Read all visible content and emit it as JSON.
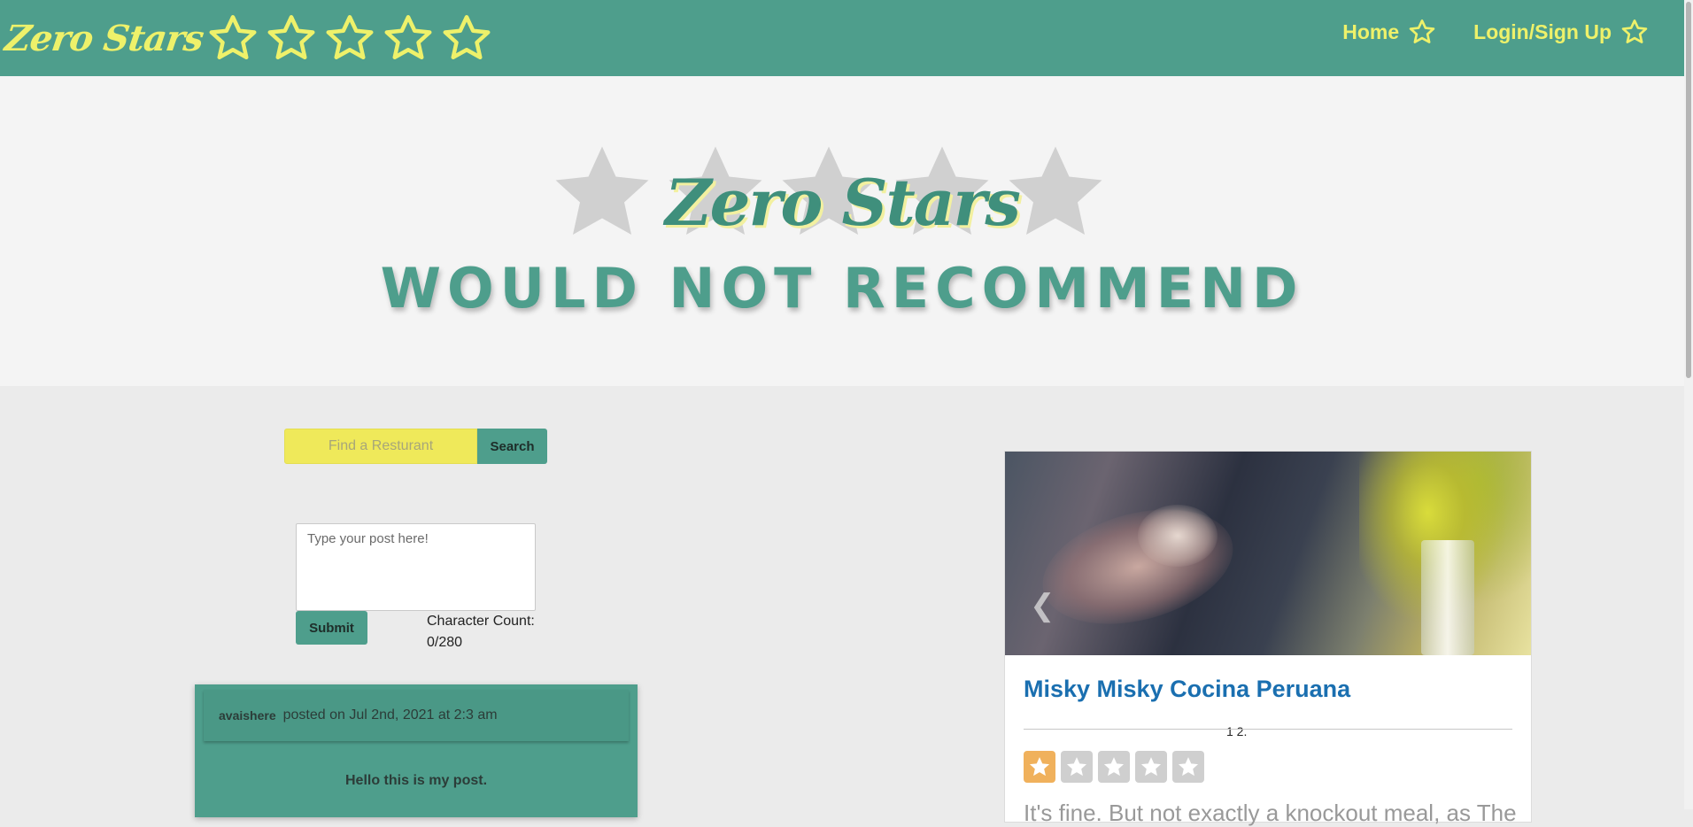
{
  "navbar": {
    "brand": "Zero Stars",
    "links": [
      {
        "label": "Home"
      },
      {
        "label": "Login/Sign Up"
      }
    ],
    "colors": {
      "background": "#4e9e8c",
      "accent": "#eef16a"
    }
  },
  "hero": {
    "title": "Zero Stars",
    "tagline": "WOULD NOT RECOMMEND"
  },
  "search": {
    "placeholder": "Find a Resturant",
    "button_label": "Search"
  },
  "post_form": {
    "placeholder": "Type your post here!",
    "submit_label": "Submit",
    "char_count_label": "Character Count:",
    "char_count_value": "0/280"
  },
  "posts": [
    {
      "author": "avaishere",
      "date": "posted on Jul 2nd, 2021 at 2:3 am",
      "body": "Hello this is my post."
    }
  ],
  "restaurant": {
    "name": "Misky Misky Cocina Peruana",
    "carousel_indicator": "1 2.",
    "rating": {
      "value": 1,
      "max": 5
    },
    "description": "It's fine. But not exactly a knockout meal, as The",
    "colors": {
      "name": "#1a6fb0",
      "rating_active": "#f0b15c",
      "rating_inactive": "#cfcfcf"
    }
  }
}
